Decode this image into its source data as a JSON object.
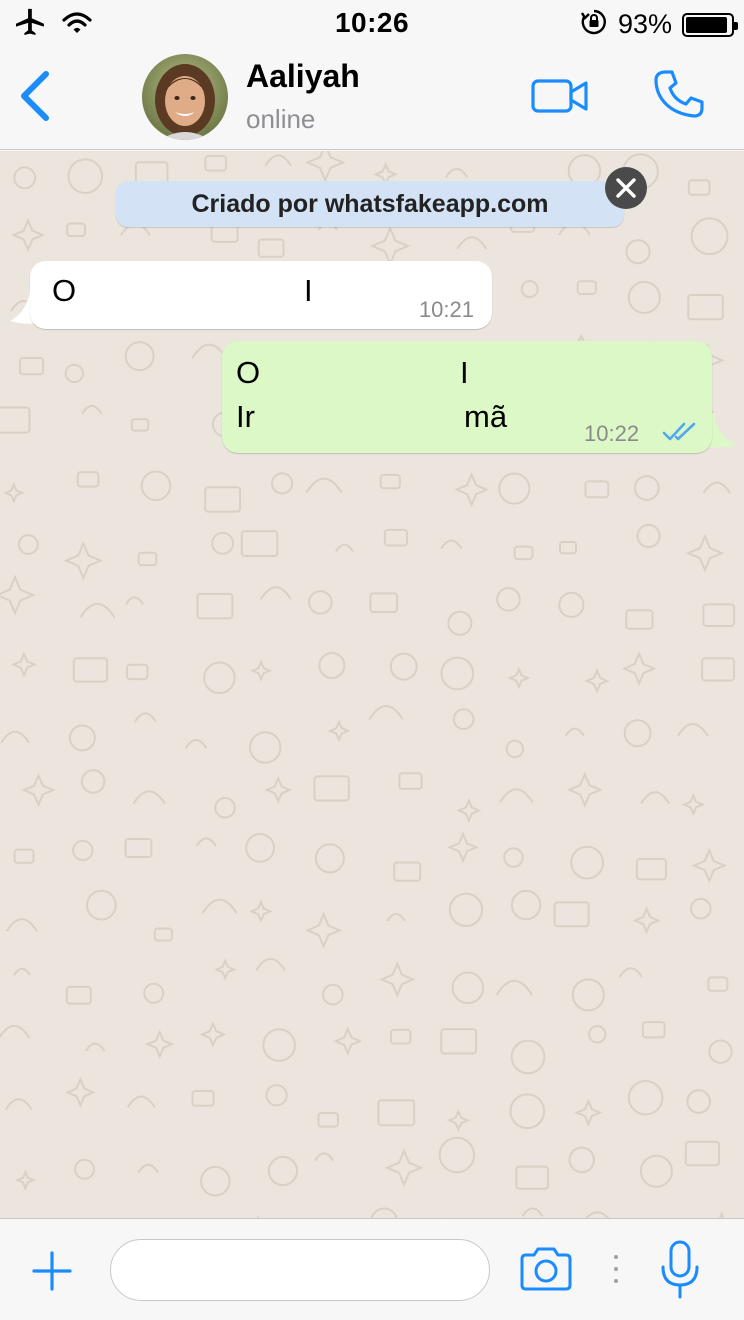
{
  "status_bar": {
    "time": "10:26",
    "battery_percent": "93%",
    "battery_level": 0.93
  },
  "header": {
    "contact_name": "Aaliyah",
    "contact_status": "online"
  },
  "banner": {
    "text": "Criado por whatsfakeapp.com"
  },
  "messages": [
    {
      "direction": "incoming",
      "lines": [
        "O",
        "I"
      ],
      "time": "10:21"
    },
    {
      "direction": "outgoing",
      "lines": [
        "O",
        "I",
        "Ir",
        "mã"
      ],
      "time": "10:22",
      "read": true
    }
  ],
  "input": {
    "placeholder": ""
  },
  "icons": [
    "airplane-icon",
    "wifi-icon",
    "rotation-lock-icon",
    "battery-icon",
    "back-chevron-icon",
    "video-call-icon",
    "phone-icon",
    "close-icon",
    "double-check-icon",
    "plus-icon",
    "camera-icon",
    "microphone-icon"
  ],
  "colors": {
    "accent": "#1b8cfe",
    "chat_background": "#ece5dd",
    "incoming_bubble": "#ffffff",
    "outgoing_bubble": "#dcf8c6",
    "banner": "#d4e2f5",
    "read_ticks": "#4fa8f0"
  }
}
